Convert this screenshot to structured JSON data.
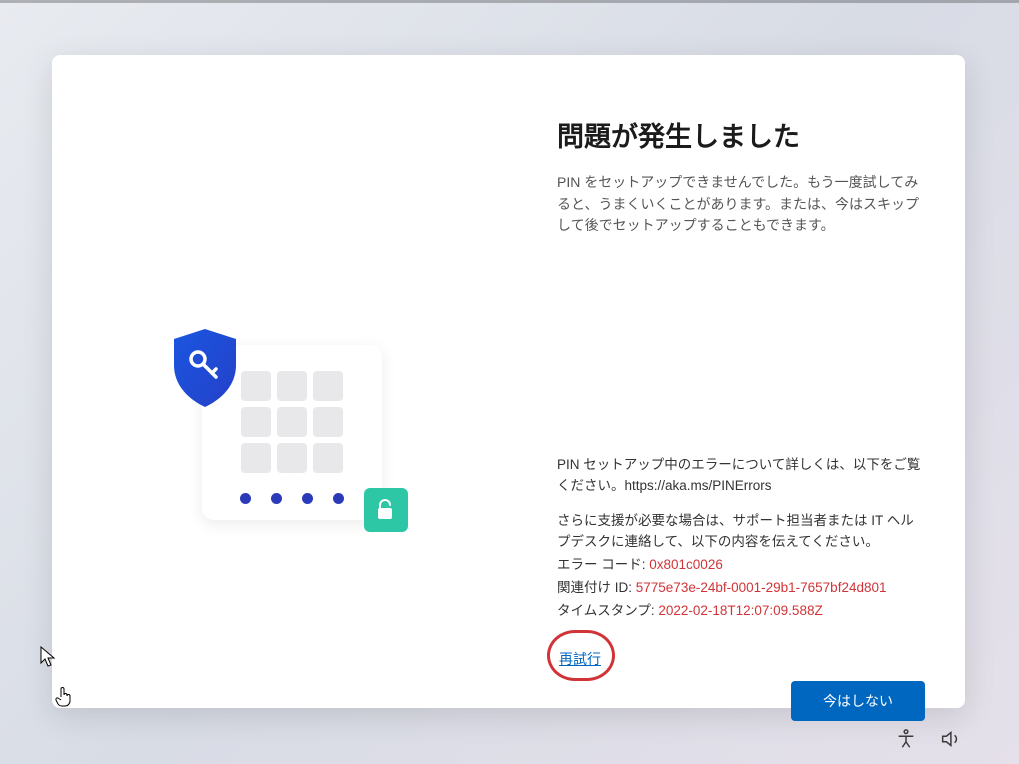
{
  "main": {
    "title": "問題が発生しました",
    "description": "PIN をセットアップできませんでした。もう一度試してみると、うまくいくことがあります。または、今はスキップして後でセットアップすることもできます。",
    "details_intro": "PIN セットアップ中のエラーについて詳しくは、以下をご覧ください。https://aka.ms/PINErrors",
    "support_text": "さらに支援が必要な場合は、サポート担当者または IT ヘルプデスクに連絡して、以下の内容を伝えてください。",
    "error_code_label": "エラー コード: ",
    "error_code_value": "0x801c0026",
    "correlation_label": "関連付け ID: ",
    "correlation_value": "5775e73e-24bf-0001-29b1-7657bf24d801",
    "timestamp_label": "タイムスタンプ: ",
    "timestamp_value": "2022-02-18T12:07:09.588Z",
    "retry_label": "再試行"
  },
  "buttons": {
    "skip": "今はしない"
  }
}
